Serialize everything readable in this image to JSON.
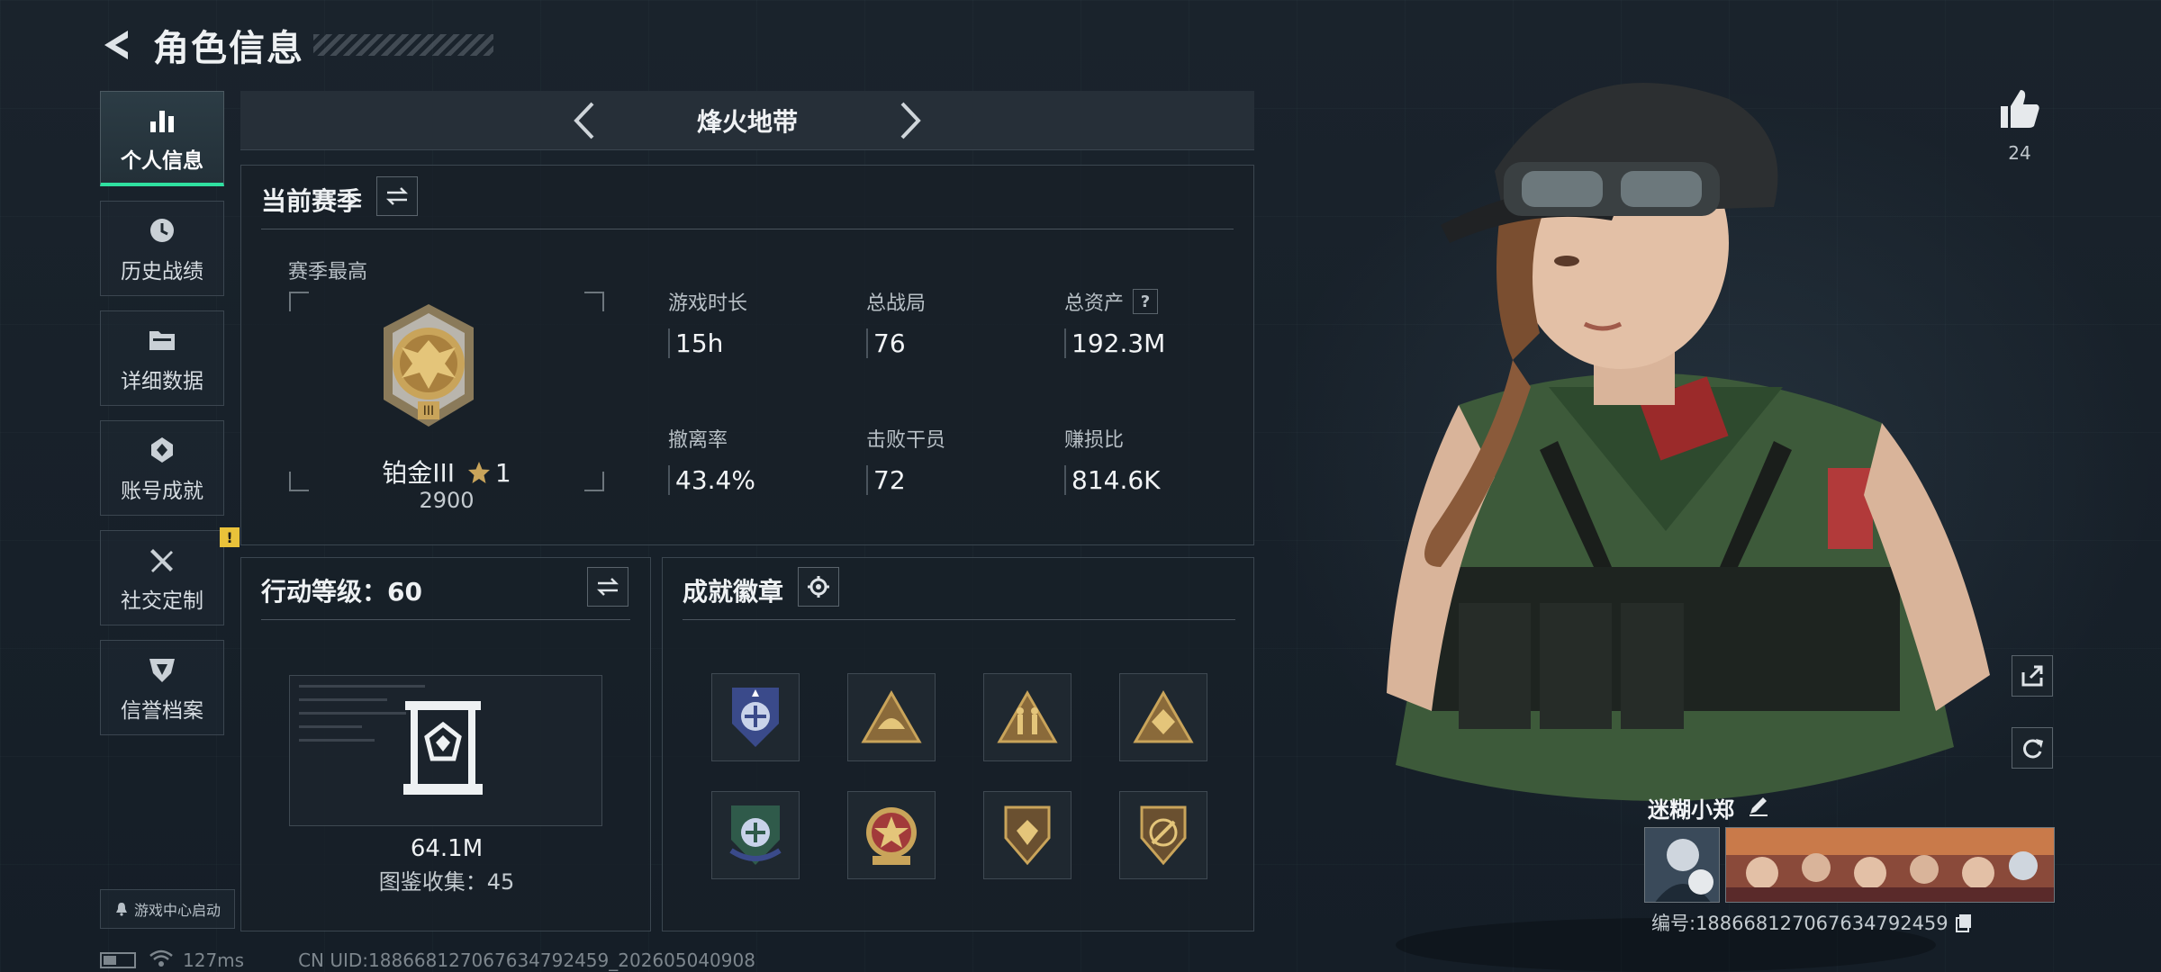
{
  "header": {
    "title": "角色信息"
  },
  "nav": {
    "items": [
      {
        "label": "个人信息",
        "icon": "bar-chart-icon",
        "active": true
      },
      {
        "label": "历史战绩",
        "icon": "history-clock-icon"
      },
      {
        "label": "详细数据",
        "icon": "folder-icon"
      },
      {
        "label": "账号成就",
        "icon": "achievement-medal-icon"
      },
      {
        "label": "社交定制",
        "icon": "tools-icon",
        "badge": "!"
      },
      {
        "label": "信誉档案",
        "icon": "reputation-shield-icon"
      }
    ],
    "launch_label": "游戏中心启动"
  },
  "mode": {
    "name": "烽火地带"
  },
  "season": {
    "title": "当前赛季",
    "subtitle": "赛季最高",
    "rank_name": "铂金III",
    "rank_stars": "1",
    "rank_score": "2900",
    "stats": [
      {
        "label": "游戏时长",
        "value": "15h"
      },
      {
        "label": "总战局",
        "value": "76"
      },
      {
        "label": "总资产",
        "value": "192.3M",
        "help": "?"
      },
      {
        "label": "撤离率",
        "value": "43.4%"
      },
      {
        "label": "击败干员",
        "value": "72"
      },
      {
        "label": "赚损比",
        "value": "814.6K"
      }
    ]
  },
  "level": {
    "title": "行动等级：60",
    "value": "64.1M",
    "codex": "图鉴收集：45"
  },
  "achievements": {
    "title": "成就徽章",
    "badges": [
      "badge-1",
      "badge-2",
      "badge-3",
      "badge-4",
      "badge-5",
      "badge-6",
      "badge-7",
      "badge-8"
    ]
  },
  "profile": {
    "likes": "24",
    "name": "迷糊小郑",
    "id_text": "编号:1886681270676347924​59"
  },
  "status": {
    "ping": "127ms",
    "uid": "CN UID:18866812706763479​2459_202605040908"
  },
  "colors": {
    "accent": "#2fe0a0",
    "notice": "#e9c23a",
    "gold": "#c9a45a"
  }
}
